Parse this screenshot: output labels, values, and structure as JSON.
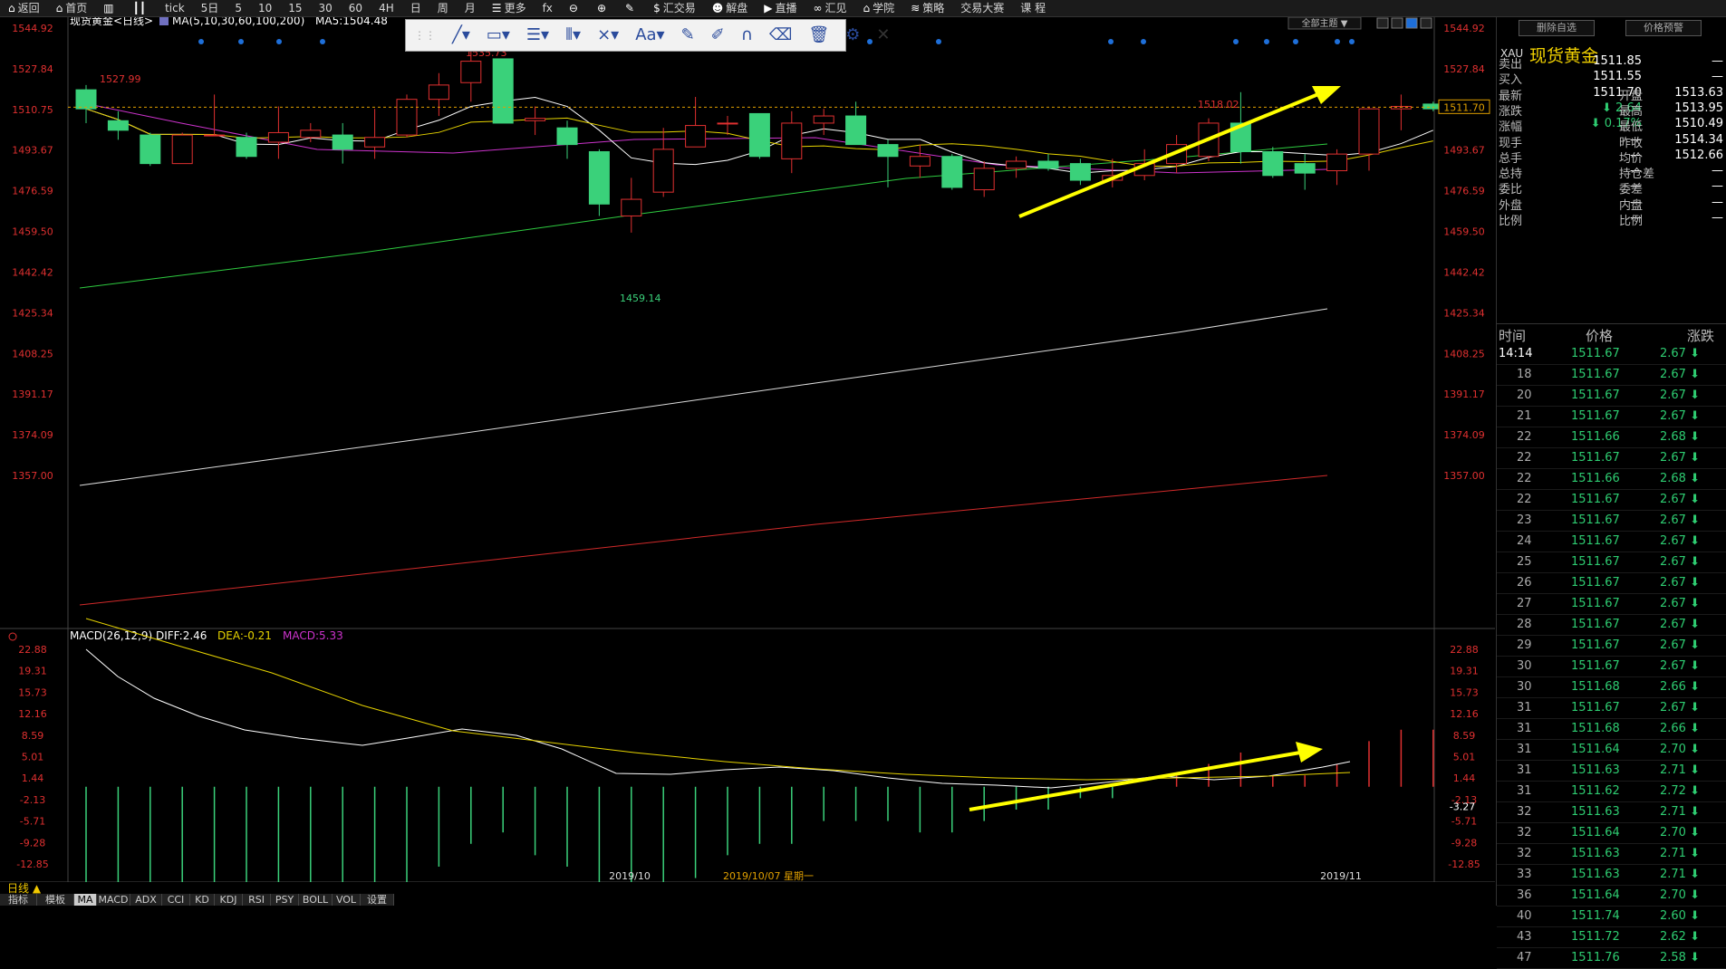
{
  "toolbar": {
    "items": [
      {
        "label": "返回",
        "icon": "home-icon"
      },
      {
        "label": "首页",
        "icon": "home-icon"
      },
      {
        "label": "",
        "icon": "bar-chart-icon"
      },
      {
        "label": "",
        "icon": "candle-icon"
      },
      {
        "label": "tick",
        "icon": ""
      },
      {
        "label": "5日",
        "icon": ""
      },
      {
        "label": "5",
        "icon": ""
      },
      {
        "label": "10",
        "icon": ""
      },
      {
        "label": "15",
        "icon": ""
      },
      {
        "label": "30",
        "icon": ""
      },
      {
        "label": "60",
        "icon": ""
      },
      {
        "label": "4H",
        "icon": ""
      },
      {
        "label": "日",
        "icon": ""
      },
      {
        "label": "周",
        "icon": ""
      },
      {
        "label": "月",
        "icon": ""
      },
      {
        "label": "更多",
        "icon": "list-icon"
      },
      {
        "label": "fx",
        "icon": ""
      },
      {
        "label": "",
        "icon": "zoom-out-icon"
      },
      {
        "label": "",
        "icon": "zoom-in-icon"
      },
      {
        "label": "",
        "icon": "pen-icon"
      },
      {
        "label": "汇交易",
        "icon": "dollar-icon"
      },
      {
        "label": "解盘",
        "icon": "people-icon"
      },
      {
        "label": "直播",
        "icon": "play-icon"
      },
      {
        "label": "汇见",
        "icon": "link-icon"
      },
      {
        "label": "学院",
        "icon": "cap-icon"
      },
      {
        "label": "策略",
        "icon": "layers-icon"
      },
      {
        "label": "交易大赛",
        "icon": ""
      },
      {
        "label": "课 程",
        "icon": ""
      }
    ]
  },
  "chart_header": {
    "symbol": "现货黄金<日线>",
    "ma_label": "MA(5,10,30,60,100,200)",
    "ma5_label": "MA5:1504.48"
  },
  "theme_button": "全部主题 ▼",
  "macd_header": {
    "name": "MACD(26,12,9)",
    "diff": "DIFF:2.46",
    "dea": "DEA:-0.21",
    "macd": "MACD:5.33"
  },
  "price_axis": [
    "1544.92",
    "1527.84",
    "1510.75",
    "1493.67",
    "1476.59",
    "1459.50",
    "1442.42",
    "1425.34",
    "1408.25",
    "1391.17",
    "1374.09",
    "1357.00"
  ],
  "macd_axis": [
    "22.88",
    "19.31",
    "15.73",
    "12.16",
    "8.59",
    "5.01",
    "1.44",
    "-2.13",
    "-5.71",
    "-9.28",
    "-12.85"
  ],
  "current_price_tag": "1511.70",
  "macd_current_tag": "-3.27",
  "x_labels": {
    "oct": "2019/10",
    "cursor": "2019/10/07 星期一",
    "nov": "2019/11"
  },
  "annotations": {
    "high1": "1527.99",
    "high2": "1535.73",
    "low": "1459.14",
    "high3": "1518.02"
  },
  "bottom_tabs": {
    "period": "日线 ▲",
    "row": [
      "指标",
      "模板",
      "MA",
      "MACD",
      "ADX",
      "CCI",
      "KD",
      "KDJ",
      "RSI",
      "PSY",
      "BOLL",
      "VOL",
      "设置"
    ]
  },
  "right_panel": {
    "btn_delete": "删除自选",
    "btn_alert": "价格预警",
    "code": "XAU",
    "name": "现货黄金",
    "quote": [
      {
        "l": "卖出",
        "v": "1511.85",
        "l2": "",
        "v2": "—"
      },
      {
        "l": "买入",
        "v": "1511.55",
        "l2": "",
        "v2": "—"
      },
      {
        "l": "最新",
        "v": "1511.70",
        "l2": "开盘",
        "v2": "1513.63"
      },
      {
        "l": "涨跌",
        "v": "⬇ 2.64",
        "l2": "最高",
        "v2": "1513.95"
      },
      {
        "l": "涨幅",
        "v": "⬇ 0.17%",
        "l2": "最低",
        "v2": "1510.49"
      },
      {
        "l": "现手",
        "v": "—",
        "l2": "昨收",
        "v2": "1514.34"
      },
      {
        "l": "总手",
        "v": "—",
        "l2": "均价",
        "v2": "1512.66"
      },
      {
        "l": "总持",
        "v": "—",
        "l2": "持仓差",
        "v2": "—"
      },
      {
        "l": "委比",
        "v": "—",
        "l2": "委差",
        "v2": "—"
      },
      {
        "l": "外盘",
        "v": "—",
        "l2": "内盘",
        "v2": "—"
      },
      {
        "l": "比例",
        "v": "—",
        "l2": "比例",
        "v2": "—"
      }
    ],
    "tick_head": {
      "time": "时间",
      "price": "价格",
      "chg": "涨跌"
    },
    "ticks": [
      {
        "t": "14:14",
        "p": "1511.67",
        "c": "2.67"
      },
      {
        "t": "18",
        "p": "1511.67",
        "c": "2.67"
      },
      {
        "t": "20",
        "p": "1511.67",
        "c": "2.67"
      },
      {
        "t": "21",
        "p": "1511.67",
        "c": "2.67"
      },
      {
        "t": "22",
        "p": "1511.66",
        "c": "2.68"
      },
      {
        "t": "22",
        "p": "1511.67",
        "c": "2.67"
      },
      {
        "t": "22",
        "p": "1511.66",
        "c": "2.68"
      },
      {
        "t": "22",
        "p": "1511.67",
        "c": "2.67"
      },
      {
        "t": "23",
        "p": "1511.67",
        "c": "2.67"
      },
      {
        "t": "24",
        "p": "1511.67",
        "c": "2.67"
      },
      {
        "t": "25",
        "p": "1511.67",
        "c": "2.67"
      },
      {
        "t": "26",
        "p": "1511.67",
        "c": "2.67"
      },
      {
        "t": "27",
        "p": "1511.67",
        "c": "2.67"
      },
      {
        "t": "28",
        "p": "1511.67",
        "c": "2.67"
      },
      {
        "t": "29",
        "p": "1511.67",
        "c": "2.67"
      },
      {
        "t": "30",
        "p": "1511.67",
        "c": "2.67"
      },
      {
        "t": "30",
        "p": "1511.68",
        "c": "2.66"
      },
      {
        "t": "31",
        "p": "1511.67",
        "c": "2.67"
      },
      {
        "t": "31",
        "p": "1511.68",
        "c": "2.66"
      },
      {
        "t": "31",
        "p": "1511.64",
        "c": "2.70"
      },
      {
        "t": "31",
        "p": "1511.63",
        "c": "2.71"
      },
      {
        "t": "31",
        "p": "1511.62",
        "c": "2.72"
      },
      {
        "t": "32",
        "p": "1511.63",
        "c": "2.71"
      },
      {
        "t": "32",
        "p": "1511.64",
        "c": "2.70"
      },
      {
        "t": "32",
        "p": "1511.63",
        "c": "2.71"
      },
      {
        "t": "33",
        "p": "1511.63",
        "c": "2.71"
      },
      {
        "t": "36",
        "p": "1511.64",
        "c": "2.70"
      },
      {
        "t": "40",
        "p": "1511.74",
        "c": "2.60"
      },
      {
        "t": "43",
        "p": "1511.72",
        "c": "2.62"
      },
      {
        "t": "47",
        "p": "1511.76",
        "c": "2.58"
      }
    ]
  },
  "chart_data": {
    "type": "candlestick",
    "ylim": [
      1340,
      1549
    ],
    "candles": [
      [
        1519,
        1511,
        1521,
        1505
      ],
      [
        1506,
        1502,
        1510,
        1498
      ],
      [
        1500,
        1488,
        1501,
        1487
      ],
      [
        1488,
        1500,
        1501,
        1488
      ],
      [
        1500,
        1500,
        1517,
        1500
      ],
      [
        1499,
        1491,
        1501,
        1490
      ],
      [
        1497,
        1501,
        1512,
        1490
      ],
      [
        1499,
        1502,
        1505,
        1497
      ],
      [
        1500,
        1494,
        1505,
        1488
      ],
      [
        1495,
        1499,
        1511,
        1490
      ],
      [
        1500,
        1515,
        1517,
        1499
      ],
      [
        1515,
        1521,
        1526,
        1508
      ],
      [
        1522,
        1531,
        1536,
        1514
      ],
      [
        1532,
        1505,
        1532,
        1505
      ],
      [
        1506,
        1507,
        1512,
        1500
      ],
      [
        1503,
        1496,
        1506,
        1490
      ],
      [
        1493,
        1471,
        1494,
        1466
      ],
      [
        1466,
        1473,
        1482,
        1459
      ],
      [
        1476,
        1494,
        1503,
        1474
      ],
      [
        1495,
        1504,
        1516,
        1495
      ],
      [
        1505,
        1505,
        1508,
        1500
      ],
      [
        1509,
        1491,
        1509,
        1490
      ],
      [
        1490,
        1505,
        1510,
        1484
      ],
      [
        1505,
        1508,
        1511,
        1500
      ],
      [
        1508,
        1496,
        1514,
        1496
      ],
      [
        1496,
        1491,
        1498,
        1478
      ],
      [
        1487,
        1491,
        1496,
        1482
      ],
      [
        1491,
        1478,
        1492,
        1477
      ],
      [
        1477,
        1486,
        1489,
        1474
      ],
      [
        1486,
        1489,
        1491,
        1482
      ],
      [
        1489,
        1486,
        1492,
        1485
      ],
      [
        1488,
        1481,
        1490,
        1479
      ],
      [
        1481,
        1483,
        1490,
        1478
      ],
      [
        1483,
        1488,
        1494,
        1481
      ],
      [
        1488,
        1496,
        1500,
        1484
      ],
      [
        1491,
        1505,
        1507,
        1489
      ],
      [
        1505,
        1493,
        1518,
        1488
      ],
      [
        1493,
        1483,
        1495,
        1482
      ],
      [
        1488,
        1484,
        1492,
        1477
      ],
      [
        1485,
        1492,
        1494,
        1479
      ],
      [
        1492,
        1511,
        1512,
        1485
      ],
      [
        1511,
        1512,
        1517,
        1502
      ],
      [
        1513,
        1511,
        1514,
        1510
      ]
    ],
    "macd_bars": [
      -18,
      -17,
      -18,
      -17,
      -16,
      -16,
      -15,
      -14,
      -13,
      -12,
      -10,
      -7,
      -5,
      -4,
      -6,
      -7,
      -10,
      -11,
      -9,
      -8,
      -6,
      -5,
      -5,
      -3,
      -3,
      -3,
      -4,
      -4,
      -3,
      -2,
      -2,
      -1,
      -1,
      0,
      1,
      2,
      3,
      1,
      1,
      2,
      4,
      5,
      5
    ]
  }
}
